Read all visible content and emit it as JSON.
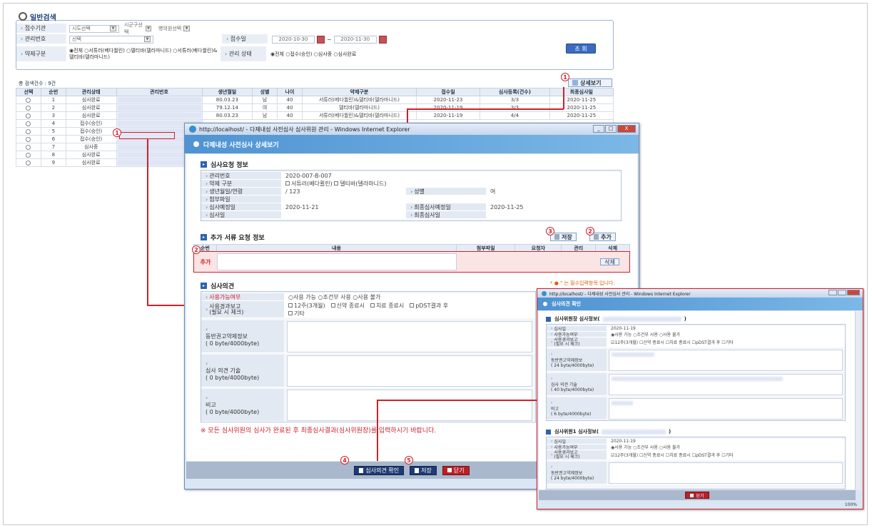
{
  "search": {
    "tab_title": "일반검색",
    "rows": {
      "agency_label": "접수기관",
      "agency_selects": [
        "시도선택",
        "시군구선택",
        "병의원선택"
      ],
      "manage_no_label": "관리번호",
      "manage_no_select": "선택",
      "receipt_date_label": "접수일",
      "date_from": "2020-10-30",
      "date_sep": "~",
      "date_to": "2020-11-30",
      "drug_type_label": "약제구분",
      "drug_type_options": "◉전체 ○서튜러(베다퀼린) ○델티바(델라마니드) ○서튜러(베다퀼린)&델티바(델라마니드)",
      "status_label": "관리 상태",
      "status_options": "◉전체 ○접수(승인) ○심사중 ○심사완료",
      "search_button": "조 회"
    }
  },
  "results": {
    "count_text": "총 검색건수 : 9건",
    "detail_button": "상세보기",
    "headers": [
      "선택",
      "순번",
      "관리상태",
      "관리번호",
      "생년월일",
      "성별",
      "나이",
      "약제구분",
      "접수일",
      "심사등록(건수)",
      "최종심사일"
    ],
    "rows": [
      [
        "1",
        "심사완료",
        "80.03.23",
        "남",
        "40",
        "서튜러(베다퀼린)&델티바(델라마니드)",
        "2020-11-23",
        "3/3",
        "2020-11-25"
      ],
      [
        "2",
        "심사완료",
        "79.12.14",
        "여",
        "40",
        "델티바(델라마니드)",
        "2020-11-19",
        "3/3",
        "2020-11-25"
      ],
      [
        "3",
        "심사완료",
        "80.03.23",
        "남",
        "40",
        "서튜러(베다퀼린)&델티바(델라마니드)",
        "2020-11-19",
        "4/4",
        "2020-11-25"
      ],
      [
        "4",
        "접수(승인)",
        "",
        "",
        "",
        "",
        "",
        "",
        ""
      ],
      [
        "5",
        "접수(승인)",
        "",
        "",
        "",
        "",
        "",
        "",
        ""
      ],
      [
        "6",
        "접수(승인)",
        "",
        "",
        "",
        "",
        "",
        "",
        ""
      ],
      [
        "7",
        "심사중",
        "",
        "",
        "",
        "",
        "",
        "",
        ""
      ],
      [
        "8",
        "심사완료",
        "",
        "",
        "",
        "",
        "",
        "",
        ""
      ],
      [
        "9",
        "심사완료",
        "",
        "",
        "",
        "",
        "",
        "",
        ""
      ]
    ]
  },
  "callouts": {
    "c1": "1",
    "c2": "2",
    "c3": "3",
    "c4": "4",
    "c5": "5"
  },
  "detail_window": {
    "title": "http://localhost/ - 다제내성 사전심사 심사위원 관리 - Windows Internet Explorer",
    "min": "_",
    "max": "□",
    "close": "X",
    "banner": "다제내성 사전심사 상세보기",
    "request_section": "심사요청 정보",
    "manage_no_label": "관리번호",
    "manage_no": "2020-007-B-007",
    "drug_label": "약제 구분",
    "drug_opt1": "서튜러(베다퀼린)",
    "drug_opt2": "델티바(델라마니드)",
    "birth_label": "생년월일/연령",
    "birth": "/ 123",
    "sex_label": "성별",
    "sex": "여",
    "attach_label": "첨부파일",
    "review_plan_label": "심사예정일",
    "review_plan": "2020-11-21",
    "final_plan_label": "최종심사예정일",
    "final_plan": "2020-11-25",
    "review_date_label": "심사일",
    "final_date_label": "최종심사일",
    "extra_section": "추가 서류 요청 정보",
    "save_btn": "저장",
    "add_btn": "추가",
    "extra_headers": [
      "순번",
      "내용",
      "첨부파일",
      "요청자",
      "관리",
      "삭제"
    ],
    "extra_row_label": "추가",
    "delete_btn": "삭제",
    "required_note": "* ● \" 는 필수입력항목 입니다.",
    "opinion_section": "심사의견",
    "usable_label": "사용가능여부",
    "usable_opts": "○사용 가능 ○조건부 사용 ○사용 불가",
    "result_label": "사용경과보고\n(필요 시 체크)",
    "result_opts": [
      "12주(3개월)",
      "신약 종료시",
      "치료 종료시",
      "pDST결과 후",
      "기타"
    ],
    "concomitant_label": "동반권고약제정보",
    "byte_counter": "( 0 byte/4000byte)",
    "opinion_label": "심사 의견 기술",
    "remark_label": "비고",
    "warning": "※ 모든 심사위원의 심사가 완료된 후 최종심사결과(심사위원장)를 입력하시기 바랍니다.",
    "confirm_btn": "심사의견 확인",
    "save2_btn": "저장",
    "close_btn": "닫기"
  },
  "opinion_window": {
    "title": "http://localhost/ - 다제내성 사전심사 관리 - Windows Internet Explorer",
    "banner": "심사의견 확인",
    "chair_section": "심사위원장 심사정보(",
    "member_section": "심사위원1 심사정보(",
    "paren": ")",
    "review_date_label": "심사일",
    "review_date": "2020-11-19",
    "usable_label": "사용가능여부",
    "usable_opts": "◉사용 가능 ○조건부 사용 ○사용 불가",
    "result_label": "사용경과보고\n(필요 시 체크)",
    "result_opts": "☑12주(3개월) ☐신약 종료시 ☐치료 종료시 ☐pDST결과 후 ☐기타",
    "concomitant_label": "동반권고약제정보",
    "byte1": "( 24 byte/4000byte)",
    "opinion_label": "심사 의견 기술",
    "byte2": "( 40 byte/4000byte)",
    "remark_label": "비고",
    "byte3": "( 6 byte/4000byte)",
    "close_btn": "닫기",
    "zoom": "100%"
  }
}
